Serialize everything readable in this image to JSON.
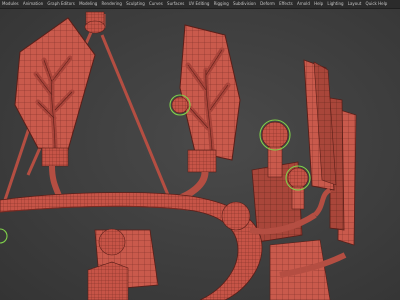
{
  "menubar": {
    "items": [
      "Modules",
      "Animation",
      "Graph Editors",
      "Modeling",
      "Rendering",
      "Sculpting",
      "Curves",
      "Surfaces",
      "UV Editing",
      "Rigging",
      "Subdivision",
      "Deform",
      "Effects",
      "Arnold",
      "Help",
      "Lighting",
      "Layout",
      "Quick Help"
    ]
  },
  "colors": {
    "background": "#3d3d3d",
    "model_red": "#c95a4c",
    "wireframe": "#5a1e18",
    "selection_green": "#7fd14a"
  }
}
